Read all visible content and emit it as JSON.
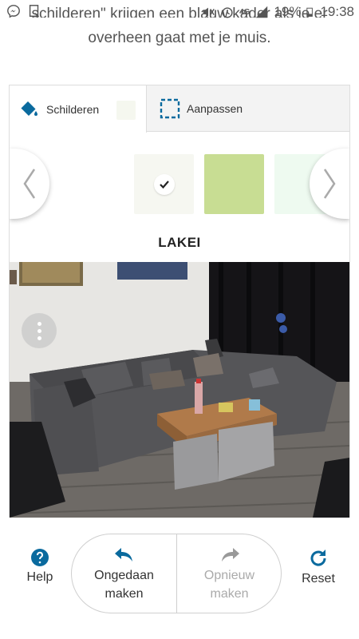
{
  "status_bar": {
    "network": "4G",
    "battery": "19%",
    "time": "19:38"
  },
  "intro": {
    "line1": "schilderen\" krijgen een blauw kader als je er",
    "line2": "overheen gaat met je muis."
  },
  "tabs": {
    "paint_label": "Schilderen",
    "adjust_label": "Aanpassen"
  },
  "selected_color": {
    "name": "LAKEI"
  },
  "swatch_colors": [
    "#f6f7f1",
    "#c8dd93",
    "#eefaf0"
  ],
  "accent_color": "#0a6a9e",
  "bottom": {
    "help_label": "Help",
    "undo_line1": "Ongedaan",
    "undo_line2": "maken",
    "redo_line1": "Opnieuw",
    "redo_line2": "maken",
    "reset_label": "Reset"
  }
}
